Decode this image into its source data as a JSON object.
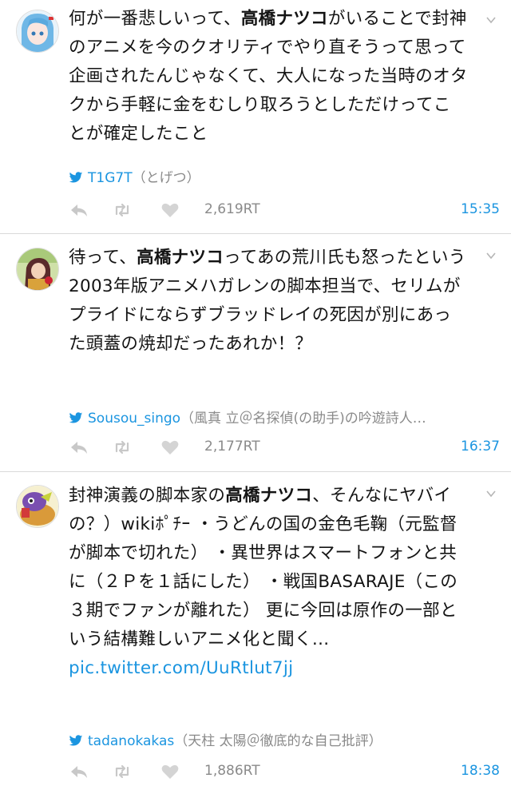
{
  "tweets": [
    {
      "text_pre": "何が一番悲しいって、",
      "text_bold": "高橋ナツコ",
      "text_post": "がいることで封神のアニメを今のクオリティでやり直そうって思って企画されたんじゃなくて、大人になった当時のオタクから手軽に金をむしり取ろうとしただけってことが確定したこと",
      "screen_name": "T1G7T",
      "display_name": "（とげつ）",
      "retweets": "2,619RT",
      "time": "15:35"
    },
    {
      "text_pre": "待って、",
      "text_bold": "高橋ナツコ",
      "text_post": "ってあの荒川氏も怒ったという2003年版アニメハガレンの脚本担当で、セリムがプライドにならずブラッドレイの死因が別にあった頭蓋の焼却だったあれか！？",
      "screen_name": "Sousou_singo",
      "display_name": "（風真 立＠名探偵(の助手)の吟遊詩人…",
      "retweets": "2,177RT",
      "time": "16:37"
    },
    {
      "text_pre": "封神演義の脚本家の",
      "text_bold": "高橋ナツコ",
      "text_post": "、そんなにヤバイの？）wikiﾎﾟﾁｰ ・うどんの国の金色毛鞠（元監督が脚本で切れた） ・異世界はスマートフォンと共に（２Ｐを１話にした） ・戦国BASARAJE（この３期でファンが離れた） 更に今回は原作の一部という結構難しいアニメ化と聞く…",
      "link": "pic.twitter.com/UuRtlut7jj",
      "screen_name": "tadanokakas",
      "display_name": "（天柱 太陽＠徹底的な自己批評）",
      "retweets": "1,886RT",
      "time": "18:38"
    }
  ],
  "icons": [
    "reply-icon",
    "retweet-icon",
    "heart-icon",
    "twitter-bird-icon",
    "chevron-down-icon"
  ],
  "colors": {
    "link": "#1b95e0",
    "muted": "#8a8a8a",
    "icon": "#c8c8c8"
  }
}
